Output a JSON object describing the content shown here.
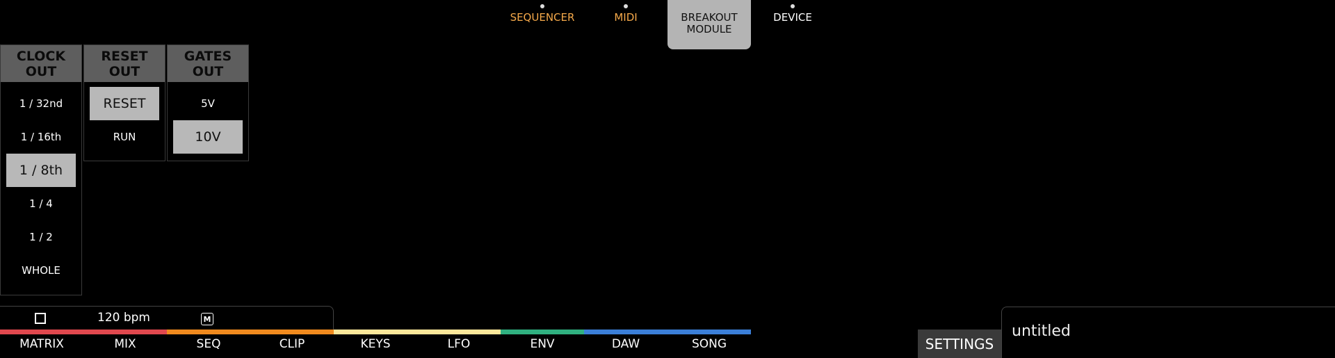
{
  "topnav": {
    "tabs": [
      {
        "label": "SEQUENCER",
        "style": "orange",
        "dot": true
      },
      {
        "label": "MIDI",
        "style": "orange",
        "dot": true
      },
      {
        "label": "BREAKOUT\nMODULE",
        "style": "active",
        "dot": false
      },
      {
        "label": "DEVICE",
        "style": "normal",
        "dot": true
      }
    ]
  },
  "breakout": {
    "clock_out": {
      "header": "CLOCK\nOUT",
      "options": [
        "1 / 32nd",
        "1 / 16th",
        "1 / 8th",
        "1 / 4",
        "1 / 2",
        "WHOLE"
      ],
      "selected": "1 / 8th"
    },
    "reset_out": {
      "header": "RESET\nOUT",
      "options": [
        "RESET",
        "RUN"
      ],
      "selected": "RESET"
    },
    "gates_out": {
      "header": "GATES\nOUT",
      "options": [
        "5V",
        "10V"
      ],
      "selected": "10V"
    }
  },
  "transport": {
    "bpm": "120 bpm",
    "midi_icon_label": "M"
  },
  "stripe_colors": [
    "#e0484e",
    "#e0484e",
    "#f08a1e",
    "#f08a1e",
    "#fbe79a",
    "#fbe79a",
    "#30b080",
    "#3b7fd8",
    "#3b7fd8"
  ],
  "bottomnav": [
    "MATRIX",
    "MIX",
    "SEQ",
    "CLIP",
    "KEYS",
    "LFO",
    "ENV",
    "DAW",
    "SONG"
  ],
  "settings_label": "SETTINGS",
  "project_name": "untitled"
}
